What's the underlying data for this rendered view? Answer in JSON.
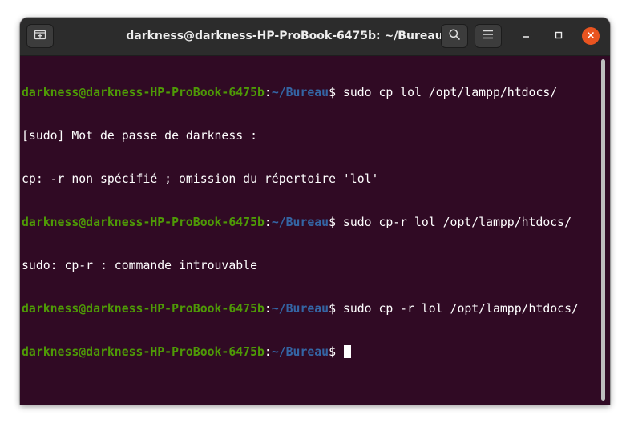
{
  "window": {
    "title": "darkness@darkness-HP-ProBook-6475b: ~/Bureau"
  },
  "titlebar": {
    "new_tab_icon": "new-tab-icon",
    "search_icon": "search-icon",
    "menu_icon": "hamburger-menu-icon",
    "minimize_icon": "minimize-icon",
    "maximize_icon": "maximize-icon",
    "close_icon": "close-icon"
  },
  "colors": {
    "terminal_bg": "#300a24",
    "prompt_user": "#4e9a06",
    "prompt_path": "#3465a4",
    "close_button": "#e95420"
  },
  "terminal": {
    "lines": [
      {
        "user": "darkness@darkness-HP-ProBook-6475b",
        "sep": ":",
        "path": "~/Bureau",
        "cmd": "$ sudo cp lol /opt/lampp/htdocs/"
      },
      {
        "text": "[sudo] Mot de passe de darkness :"
      },
      {
        "text": "cp: -r non spécifié ; omission du répertoire 'lol'"
      },
      {
        "user": "darkness@darkness-HP-ProBook-6475b",
        "sep": ":",
        "path": "~/Bureau",
        "cmd": "$ sudo cp-r lol /opt/lampp/htdocs/"
      },
      {
        "text": "sudo: cp-r : commande introuvable"
      },
      {
        "user": "darkness@darkness-HP-ProBook-6475b",
        "sep": ":",
        "path": "~/Bureau",
        "cmd": "$ sudo cp -r lol /opt/lampp/htdocs/"
      },
      {
        "user": "darkness@darkness-HP-ProBook-6475b",
        "sep": ":",
        "path": "~/Bureau",
        "cmd": "$ "
      }
    ]
  }
}
